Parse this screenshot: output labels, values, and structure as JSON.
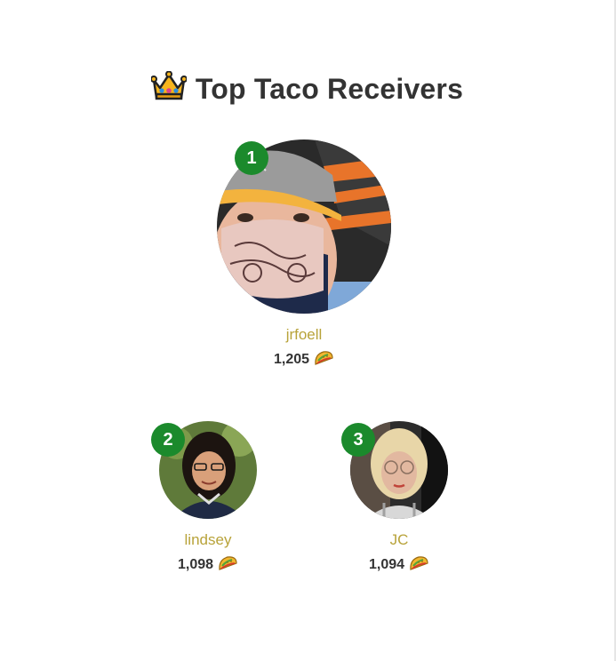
{
  "header": {
    "title": "Top Taco Receivers",
    "icon": "crown-icon"
  },
  "leaders": [
    {
      "rank": "1",
      "username": "jrfoell",
      "count": "1,205",
      "icon": "taco-icon"
    },
    {
      "rank": "2",
      "username": "lindsey",
      "count": "1,098",
      "icon": "taco-icon"
    },
    {
      "rank": "3",
      "username": "JC",
      "count": "1,094",
      "icon": "taco-icon"
    }
  ],
  "colors": {
    "badge": "#1b8a2c",
    "username": "#b8a33a",
    "text": "#333333"
  }
}
